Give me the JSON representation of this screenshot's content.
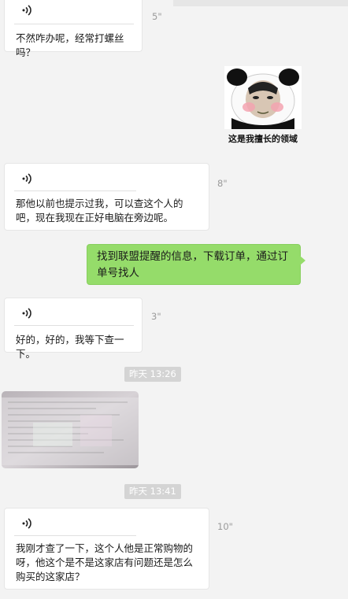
{
  "messages": [
    {
      "id": "m1",
      "side": "left",
      "kind": "voice",
      "text": "不然咋办呢，经常打螺丝吗？",
      "duration": "5\""
    },
    {
      "id": "m2",
      "side": "right",
      "kind": "sticker",
      "caption": "这是我擅长的领域"
    },
    {
      "id": "m3",
      "side": "left",
      "kind": "voice",
      "text": "那他以前也提示过我，可以查这个人的吧，现在我现在正好电脑在旁边呢。",
      "duration": "8\""
    },
    {
      "id": "m4",
      "side": "right",
      "kind": "text",
      "text": "找到联盟提醒的信息，下载订单，通过订单号找人"
    },
    {
      "id": "m5",
      "side": "left",
      "kind": "voice",
      "text": "好的，好的，我等下查一下。",
      "duration": "3\""
    },
    {
      "id": "t1",
      "kind": "timestamp",
      "text": "昨天 13:26"
    },
    {
      "id": "m6",
      "side": "left",
      "kind": "image"
    },
    {
      "id": "t2",
      "kind": "timestamp",
      "text": "昨天 13:41"
    },
    {
      "id": "m7",
      "side": "left",
      "kind": "voice",
      "text": "我刚才查了一下，这个人他是正常购物的呀，他这个是不是这家店有问题还是怎么购买的这家店？",
      "duration": "10\""
    }
  ],
  "colors": {
    "background": "#f3f3f3",
    "bubble_green": "#95dc6a",
    "timestamp_bg": "#d4d4d4"
  },
  "icons": {
    "voice": "voice-wave-icon"
  }
}
